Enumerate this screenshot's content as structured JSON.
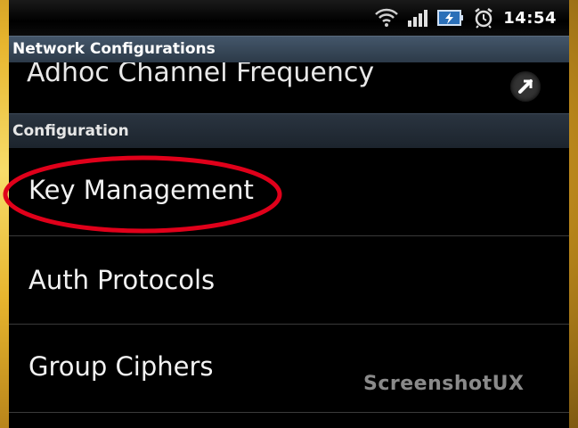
{
  "status_bar": {
    "time": "14:54",
    "icons": [
      "wifi-icon",
      "signal-icon",
      "battery-charging-icon",
      "alarm-icon"
    ]
  },
  "title_bar": {
    "title": "Network Configurations"
  },
  "adhoc": {
    "label": "Adhoc Channel Frequency",
    "icon": "chevron-right-icon"
  },
  "configuration_header": {
    "label": "Configuration"
  },
  "items": [
    {
      "label": "Key Management"
    },
    {
      "label": "Auth Protocols"
    },
    {
      "label": "Group Ciphers"
    }
  ],
  "watermark": {
    "text": "ScreenshotUX"
  },
  "colors": {
    "highlight": "#e0001a",
    "header_bg": "#2c3a48",
    "background": "#000000",
    "wallpaper": "#e7b52e"
  }
}
